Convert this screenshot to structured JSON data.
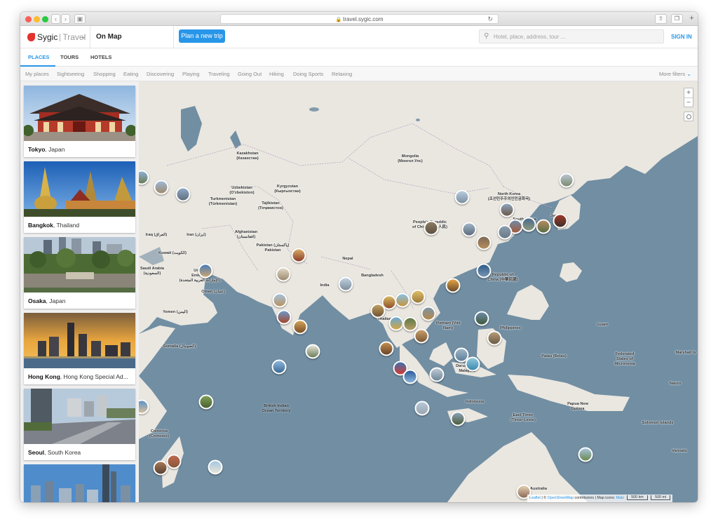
{
  "browser": {
    "url": "travel.sygic.com"
  },
  "header": {
    "logo_primary": "Sygic",
    "logo_secondary": "Travel",
    "mode_label": "On Map",
    "plan_button": "Plan a new trip",
    "search_placeholder": "Hotel, place, address, tour ...",
    "sign_in": "SIGN IN"
  },
  "tabs": [
    {
      "label": "PLACES",
      "active": true
    },
    {
      "label": "TOURS",
      "active": false
    },
    {
      "label": "HOTELS",
      "active": false
    }
  ],
  "filters": [
    "My places",
    "Sightseeing",
    "Shopping",
    "Eating",
    "Discovering",
    "Playing",
    "Traveling",
    "Going Out",
    "Hiking",
    "Doing Sports",
    "Relaxing"
  ],
  "more_filters": "More filters",
  "places": [
    {
      "city": "Tokyo",
      "country": "Japan"
    },
    {
      "city": "Bangkok",
      "country": "Thailand"
    },
    {
      "city": "Osaka",
      "country": "Japan"
    },
    {
      "city": "Hong Kong",
      "country": "Hong Kong Special Ad..."
    },
    {
      "city": "Seoul",
      "country": "South Korea"
    }
  ],
  "map": {
    "labels": [
      "Kazakhstan",
      "(Казахстан)",
      "Mongolia",
      "(Монгол Улс)",
      "Uzbekistan",
      "(O'zbekiston)",
      "Kyrgyzstan",
      "(Кыргызстан)",
      "Turkmenistan",
      "(Türkmenistan)",
      "Tajikistan",
      "(Тоҷикистон)",
      "North Korea",
      "(조선민주주의인민공화국)",
      "People's Republic",
      "of China (中华人民)",
      "Afghanistan",
      "(افغانستان)",
      "Pakistan (پاکستان)",
      "Pakistan",
      "Iraq (العراق)",
      "Iran (ایران)",
      "Kuwait (الكويت)",
      "Saudi Arabia",
      "(السعودية)",
      "United",
      "Emirates",
      "(الإمارات العربية المتحدة)",
      "Oman (عمان)",
      "Nepal",
      "India",
      "Bangladesh",
      "Yemen (اليمن)",
      "Somalia (الصومال)",
      "Thailand",
      "Vietnam (Việt",
      "Nam)",
      "Philippines",
      "Republic of",
      "China (中華民國)",
      "Guam",
      "Palau (Belau)",
      "Federated",
      "States of",
      "Micronesia",
      "Marshall Is",
      "Brunei",
      "Darussalam",
      "Malaysia",
      "Indonesia",
      "Nauru",
      "Papua New",
      "Guinea",
      "East Timor",
      "(Timor-Leste)",
      "British Indian",
      "Ocean Territory",
      "Comoros",
      "(Comores)",
      "Solomon Islands",
      "Vanuatu",
      "Australia",
      "Japan",
      "South Korea"
    ],
    "zoom_in": "+",
    "zoom_out": "−",
    "attribution_leaflet": "Leaflet",
    "attribution_mid": "| © ",
    "attribution_osm": "OpenStreetMap",
    "attribution_contrib": "contributors | Map icons:",
    "attribution_maki": "Maki",
    "scale_km": "500 km",
    "scale_mi": "500 mi"
  }
}
